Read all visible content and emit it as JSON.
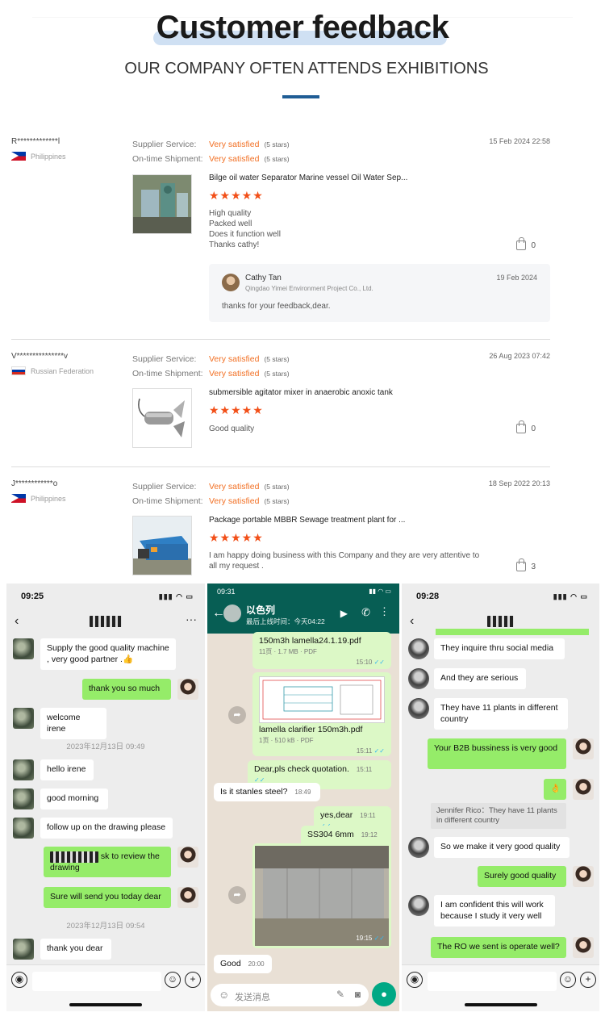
{
  "header": {
    "title": "Customer feedback",
    "subtitle": "OUR COMPANY OFTEN ATTENDS EXHIBITIONS"
  },
  "labels": {
    "supplier_service": "Supplier Service:",
    "ontime_shipment": "On-time Shipment:"
  },
  "reviews": [
    {
      "user": "R*************l",
      "country": "Philippines",
      "flag": "ph",
      "service_rating": "Very satisfied",
      "service_stars": "(5 stars)",
      "shipment_rating": "Very satisfied",
      "shipment_stars": "(5 stars)",
      "date": "15 Feb 2024 22:58",
      "product": "Bilge oil water Separator Marine vessel Oil Water Sep...",
      "stars": "★★★★★",
      "rating": 5,
      "comment": [
        "High quality",
        "Packed well",
        "Does it function well",
        "Thanks cathy!"
      ],
      "likes": "0",
      "reply": {
        "name": "Cathy Tan",
        "company": "Qingdao Yimei Environment Project Co., Ltd.",
        "date": "19 Feb 2024",
        "text": "thanks for your feedback,dear."
      }
    },
    {
      "user": "V***************v",
      "country": "Russian Federation",
      "flag": "ru",
      "service_rating": "Very satisfied",
      "service_stars": "(5 stars)",
      "shipment_rating": "Very satisfied",
      "shipment_stars": "(5 stars)",
      "date": "26 Aug 2023 07:42",
      "product": "submersible agitator mixer in anaerobic anoxic tank",
      "stars": "★★★★★",
      "rating": 5,
      "comment": "Good quality",
      "likes": "0"
    },
    {
      "user": "J************o",
      "country": "Philippines",
      "flag": "ph",
      "service_rating": "Very satisfied",
      "service_stars": "(5 stars)",
      "shipment_rating": "Very satisfied",
      "shipment_stars": "(5 stars)",
      "date": "18 Sep 2022 20:13",
      "product": "Package portable MBBR Sewage treatment plant for ...",
      "stars": "★★★★★",
      "rating": 5,
      "comment": "I am happy doing business with this Company and they are very attentive to all my request .",
      "likes": "3"
    }
  ],
  "chat1": {
    "time": "09:25",
    "title": "▪▪ ▪▪▪ ▪▪▪",
    "messages": {
      "m1": "Supply the good quality machine , very good partner .👍",
      "m2": "thank you so much",
      "m3": "welcome irene",
      "ts1": "2023年12月13日 09:49",
      "m4": "hello irene",
      "m5": "good morning",
      "m6": "follow up on the drawing please",
      "m7": "sk to review the drawing",
      "m8": "Sure will send you today dear",
      "ts2": "2023年12月13日 09:54",
      "m9": "thank you dear"
    }
  },
  "chat2": {
    "time": "09:31",
    "contact": "以色列",
    "last_seen": "最后上线时间：今天04:22",
    "file1_name": "150m3h lamella24.1.19.pdf",
    "file1_meta": "11页 · 1.7 MB · PDF",
    "file1_time": "15:10",
    "file2_name": "lamella clarifier 150m3h.pdf",
    "file2_meta": "1页 · 510 kB · PDF",
    "file2_time": "15:11",
    "m1": "Dear,pls check quotation.",
    "m1_time": "15:11",
    "m2": "Is it stanles steel?",
    "m2_time": "18:49",
    "m3": "yes,dear",
    "m3_time": "19:11",
    "m4": "SS304 6mm",
    "m4_time": "19:12",
    "img_time": "19:15",
    "m5": "Good",
    "m5_time": "20:00",
    "input_placeholder": "发送消息"
  },
  "chat3": {
    "time": "09:28",
    "title": "▪▪▪ ▪▪▪▪",
    "messages": {
      "m1": "They inquire thru social media",
      "m2": "And they are serious",
      "m3": "They have 11 plants in different country",
      "m4": "Your B2B bussiness is very good",
      "m5": "👌",
      "quote": "Jennifer Rico：They have 11 plants in different country",
      "m6": "So we make it very good quality",
      "m7": "Surely good quality",
      "m8": "I am confident this will work because I study it very well",
      "m9": "The RO we sent is operate well?"
    }
  },
  "colors": {
    "accent": "#f27024",
    "stars": "#f24f18",
    "title_bar": "#1f5d95",
    "wechat_green": "#95ec69",
    "whatsapp_header": "#075e54"
  }
}
